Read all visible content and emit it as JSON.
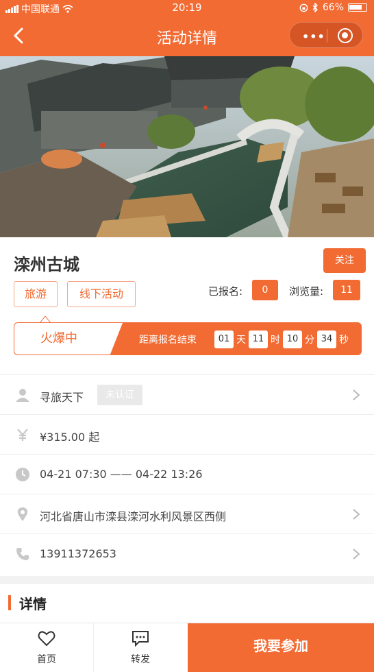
{
  "status_bar": {
    "carrier": "中国联通",
    "time": "20:19",
    "battery": "66%"
  },
  "nav": {
    "title": "活动详情",
    "more_icon": "more-dots-icon",
    "close_icon": "target-icon"
  },
  "hero": {
    "icon": "photo-canal-town"
  },
  "activity": {
    "name": "滦州古城",
    "follow_label": "关注",
    "tags": [
      "旅游",
      "线下活动"
    ],
    "signed_label": "已报名:",
    "signed_count": "0",
    "views_label": "浏览量:",
    "views_count": "11"
  },
  "countdown": {
    "status": "火爆中",
    "label": "距离报名结束",
    "days": "01",
    "days_unit": "天",
    "hours": "11",
    "hours_unit": "时",
    "minutes": "10",
    "minutes_unit": "分",
    "seconds": "34",
    "seconds_unit": "秒"
  },
  "info": {
    "organizer": "寻旅天下",
    "organizer_badge": "未认证",
    "price": "¥315.00 起",
    "time_range": "04-21 07:30 —— 04-22 13:26",
    "address": "河北省唐山市滦县滦河水利风景区西侧",
    "phone": "13911372653"
  },
  "details_title": "详情",
  "toolbar": {
    "home": "首页",
    "share": "转发",
    "join": "我要参加"
  },
  "colors": {
    "accent": "#f26b33",
    "icon_gray": "#c8c8c8"
  }
}
